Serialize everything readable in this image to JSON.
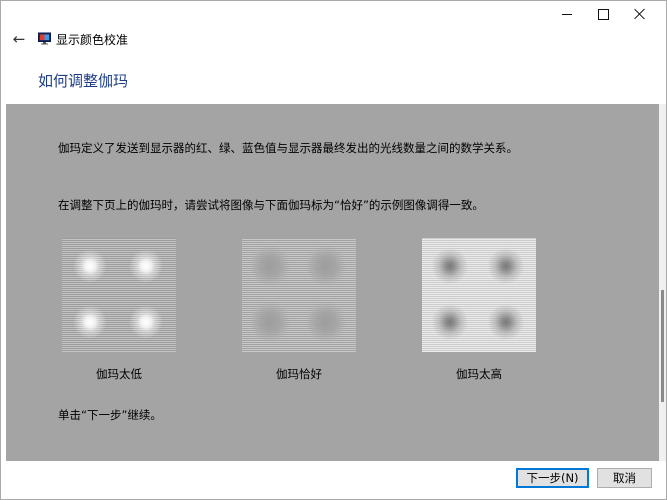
{
  "window": {
    "title": "显示颜色校准",
    "controls": [
      "minimize",
      "maximize",
      "close"
    ]
  },
  "page": {
    "heading": "如何调整伽玛",
    "paragraph1": "伽玛定义了发送到显示器的红、绿、蓝色值与显示器最终发出的光线数量之间的数学关系。",
    "paragraph2": "在调整下页上的伽玛时，请尝试将图像与下面伽玛标为“恰好”的示例图像调得一致。",
    "samples": [
      {
        "label": "伽玛太低"
      },
      {
        "label": "伽玛恰好"
      },
      {
        "label": "伽玛太高"
      }
    ],
    "instruction": "单击“下一步”继续。"
  },
  "buttons": {
    "next": "下一步(N)",
    "cancel": "取消"
  },
  "colors": {
    "heading": "#1e3f87",
    "content_background": "#a4a4a4",
    "default_button_border": "#0078d7"
  },
  "icons": {
    "back": "back-arrow-icon",
    "app": "monitor-icon"
  }
}
